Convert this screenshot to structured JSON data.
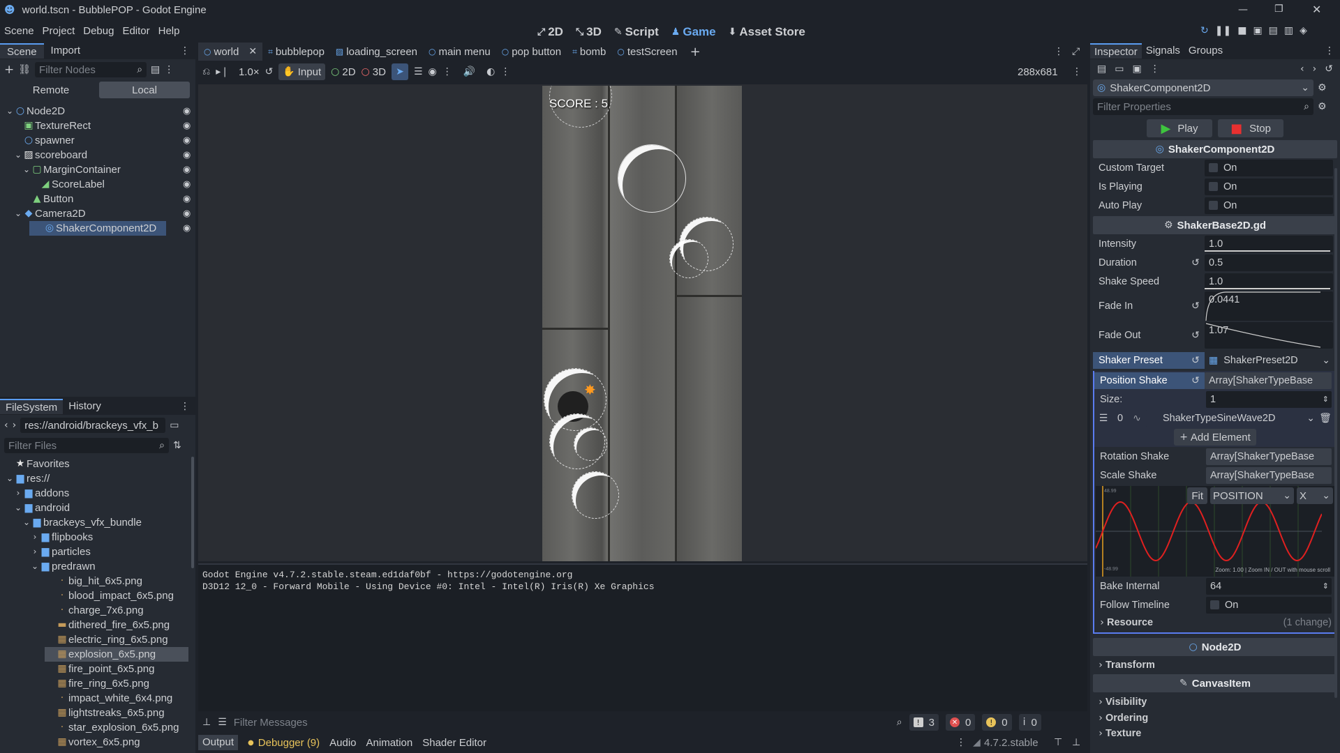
{
  "title_bar": {
    "title": "world.tscn - BubblePOP - Godot Engine"
  },
  "menu": [
    "Scene",
    "Project",
    "Debug",
    "Editor",
    "Help"
  ],
  "workspaces": [
    {
      "icon": "2d-icon",
      "label": "2D"
    },
    {
      "icon": "3d-icon",
      "label": "3D"
    },
    {
      "icon": "script-icon",
      "label": "Script"
    },
    {
      "icon": "game-icon",
      "label": "Game"
    },
    {
      "icon": "asset-store-icon",
      "label": "Asset Store"
    }
  ],
  "left_dock_tabs": [
    "Scene",
    "Import"
  ],
  "scene": {
    "filter_placeholder": "Filter Nodes",
    "remote": "Remote",
    "local": "Local",
    "nodes": [
      {
        "name": "Node2D",
        "indent": 0,
        "icon": "○",
        "color": "#6aaaf0",
        "arrow": "⌄"
      },
      {
        "name": "TextureRect",
        "indent": 1,
        "icon": "▣",
        "color": "#7ed07e",
        "arrow": ""
      },
      {
        "name": "spawner",
        "indent": 1,
        "icon": "○",
        "color": "#6aaaf0",
        "arrow": ""
      },
      {
        "name": "scoreboard",
        "indent": 1,
        "icon": "▨",
        "color": "#e8e8e8",
        "arrow": "⌄"
      },
      {
        "name": "MarginContainer",
        "indent": 2,
        "icon": "▢",
        "color": "#7ed07e",
        "arrow": "⌄"
      },
      {
        "name": "ScoreLabel",
        "indent": 3,
        "icon": "◢",
        "color": "#7ed07e",
        "arrow": ""
      },
      {
        "name": "Button",
        "indent": 2,
        "icon": "▲",
        "color": "#7ed07e",
        "arrow": ""
      },
      {
        "name": "Camera2D",
        "indent": 1,
        "icon": "◆",
        "color": "#6aaaf0",
        "arrow": "⌄"
      },
      {
        "name": "ShakerComponent2D",
        "indent": 2,
        "icon": "◎",
        "color": "#6aaaf0",
        "arrow": "",
        "selected": true
      }
    ]
  },
  "filesystem": {
    "tabs": [
      "FileSystem",
      "History"
    ],
    "path": "res://android/brackeys_vfx_b",
    "filter_placeholder": "Filter Files",
    "items": [
      {
        "name": "Favorites",
        "indent": 0,
        "icon": "★",
        "arrow": ""
      },
      {
        "name": "res://",
        "indent": 0,
        "icon": "▆",
        "arrow": "⌄"
      },
      {
        "name": "addons",
        "indent": 1,
        "icon": "▆",
        "arrow": "›"
      },
      {
        "name": "android",
        "indent": 1,
        "icon": "▆",
        "arrow": "⌄"
      },
      {
        "name": "brackeys_vfx_bundle",
        "indent": 2,
        "icon": "▆",
        "arrow": "⌄"
      },
      {
        "name": "flipbooks",
        "indent": 3,
        "icon": "▆",
        "arrow": "›"
      },
      {
        "name": "particles",
        "indent": 3,
        "icon": "▆",
        "arrow": "›"
      },
      {
        "name": "predrawn",
        "indent": 3,
        "icon": "▆",
        "arrow": "⌄"
      },
      {
        "name": "big_hit_6x5.png",
        "indent": 5,
        "icon": "·",
        "arrow": ""
      },
      {
        "name": "blood_impact_6x5.png",
        "indent": 5,
        "icon": "·",
        "arrow": ""
      },
      {
        "name": "charge_7x6.png",
        "indent": 5,
        "icon": "·",
        "arrow": ""
      },
      {
        "name": "dithered_fire_6x5.png",
        "indent": 5,
        "icon": "▬",
        "arrow": ""
      },
      {
        "name": "electric_ring_6x5.png",
        "indent": 5,
        "icon": "▦",
        "arrow": ""
      },
      {
        "name": "explosion_6x5.png",
        "indent": 5,
        "icon": "▦",
        "arrow": "",
        "selected": true
      },
      {
        "name": "fire_point_6x5.png",
        "indent": 5,
        "icon": "▦",
        "arrow": ""
      },
      {
        "name": "fire_ring_6x5.png",
        "indent": 5,
        "icon": "▦",
        "arrow": ""
      },
      {
        "name": "impact_white_6x4.png",
        "indent": 5,
        "icon": "·",
        "arrow": ""
      },
      {
        "name": "lightstreaks_6x5.png",
        "indent": 5,
        "icon": "▦",
        "arrow": ""
      },
      {
        "name": "star_explosion_6x5.png",
        "indent": 5,
        "icon": "·",
        "arrow": ""
      },
      {
        "name": "vortex_6x5.png",
        "indent": 5,
        "icon": "▦",
        "arrow": ""
      }
    ]
  },
  "editor_tabs": [
    {
      "label": "world",
      "icon": "○",
      "active": true,
      "close": "✕"
    },
    {
      "label": "bubblepop",
      "icon": "⌗"
    },
    {
      "label": "loading_screen",
      "icon": "▨"
    },
    {
      "label": "main menu",
      "icon": "○"
    },
    {
      "label": "pop button",
      "icon": "○"
    },
    {
      "label": "bomb",
      "icon": "⌗"
    },
    {
      "label": "testScreen",
      "icon": "○"
    }
  ],
  "game_toolbar": {
    "zoom": "1.0×",
    "input": "Input",
    "mode2d": "2D",
    "mode3d": "3D",
    "resolution": "288x681"
  },
  "game": {
    "score": "SCORE : 5"
  },
  "output": {
    "lines": [
      "Godot Engine v4.7.2.stable.steam.ed1daf0bf - https://godotengine.org",
      "D3D12 12_0 - Forward Mobile - Using Device #0: Intel - Intel(R) Iris(R) Xe Graphics"
    ],
    "filter_placeholder": "Filter Messages",
    "counts": [
      "3",
      "0",
      "0",
      "0"
    ],
    "bottom_tabs": [
      "Output",
      "Debugger (9)",
      "Audio",
      "Animation",
      "Shader Editor"
    ],
    "version": "4.7.2.stable"
  },
  "inspector": {
    "tabs": [
      "Inspector",
      "Signals",
      "Groups"
    ],
    "object": "ShakerComponent2D",
    "filter_placeholder": "Filter Properties",
    "play": "Play",
    "stop": "Stop",
    "class_header": "ShakerComponent2D",
    "props_a": [
      {
        "name": "Custom Target",
        "value": "On"
      },
      {
        "name": "Is Playing",
        "value": "On"
      },
      {
        "name": "Auto Play",
        "value": "On"
      }
    ],
    "script_header": "ShakerBase2D.gd",
    "intensity": {
      "name": "Intensity",
      "value": "1.0"
    },
    "duration": {
      "name": "Duration",
      "value": "0.5"
    },
    "shake_speed": {
      "name": "Shake Speed",
      "value": "1.0"
    },
    "fade_in": {
      "name": "Fade In",
      "value": "0.0441"
    },
    "fade_out": {
      "name": "Fade Out",
      "value": "1.07"
    },
    "preset": {
      "name": "Shaker Preset",
      "value": "ShakerPreset2D"
    },
    "position_shake": {
      "name": "Position Shake",
      "value": "Array[ShakerTypeBase"
    },
    "size": {
      "name": "Size:",
      "value": "1"
    },
    "element": {
      "index": "0",
      "value": "ShakerTypeSineWave2D"
    },
    "add_element": "Add Element",
    "rotation_shake": {
      "name": "Rotation Shake",
      "value": "Array[ShakerTypeBase"
    },
    "scale_shake": {
      "name": "Scale Shake",
      "value": "Array[ShakerTypeBase"
    },
    "graph": {
      "fit": "Fit",
      "mode": "POSITION",
      "axis": "X",
      "top": "48.99",
      "bottom": "-48.99",
      "footer": "Zoom: 1.00  |  Zoom IN / OUT with mouse scroll"
    },
    "bake": {
      "name": "Bake Internal",
      "value": "64"
    },
    "follow": {
      "name": "Follow Timeline",
      "value": "On"
    },
    "resource": {
      "name": "Resource",
      "note": "(1 change)"
    },
    "node2d_header": "Node2D",
    "transform": "Transform",
    "canvasitem_header": "CanvasItem",
    "sub": [
      "Visibility",
      "Ordering",
      "Texture"
    ]
  },
  "colors": {
    "accent": "#5a9cf0",
    "selection": "#3c5478",
    "sine": "#e02020"
  }
}
